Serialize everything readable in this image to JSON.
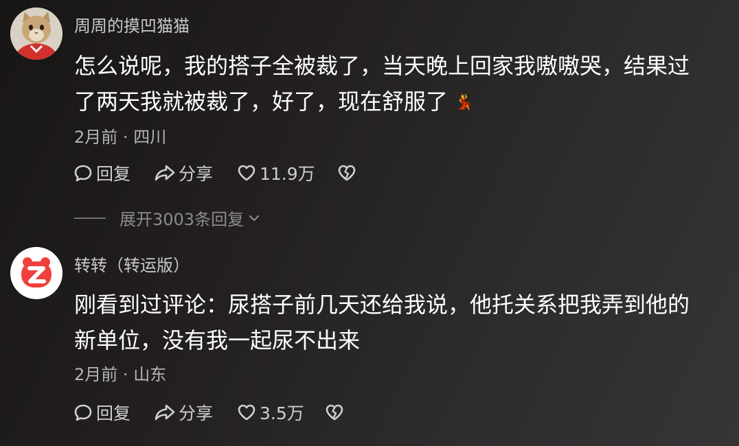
{
  "comments": [
    {
      "username": "周周的摸凹猫猫",
      "text_lines": [
        "怎么说呢，我的搭子全被裁了，当天晚上回家我嗷嗷哭，结果过",
        "了两天我就被裁了，好了，现在舒服了"
      ],
      "emoji": "💃",
      "time": "2月前",
      "separator": "·",
      "location": "四川",
      "reply_label": "回复",
      "share_label": "分享",
      "like_count": "11.9万",
      "expand_label": "展开3003条回复",
      "icons": [
        "reply-icon",
        "share-icon",
        "heart-icon",
        "broken-heart-icon",
        "chevron-down-icon"
      ]
    },
    {
      "username": "转转（转运版）",
      "text_lines": [
        "刚看到过评论：尿搭子前几天还给我说，他托关系把我弄到他的",
        "新单位，没有我一起尿不出来"
      ],
      "time": "2月前",
      "separator": "·",
      "location": "山东",
      "reply_label": "回复",
      "share_label": "分享",
      "like_count": "3.5万",
      "icons": [
        "reply-icon",
        "share-icon",
        "heart-icon",
        "broken-heart-icon"
      ]
    }
  ],
  "colors": {
    "avatar_badge": "#f0403c",
    "text_primary": "#ffffff",
    "text_secondary": "#b5b5b5",
    "text_muted": "#8c8c8c"
  }
}
